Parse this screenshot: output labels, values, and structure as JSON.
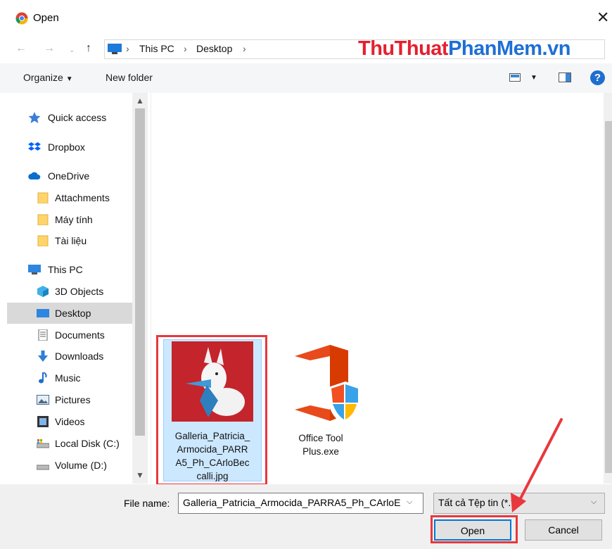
{
  "window": {
    "title": "Open"
  },
  "address": {
    "crumbs": [
      "This PC",
      "Desktop"
    ],
    "watermark_red": "ThuThuat",
    "watermark_blue": "PhanMem.vn"
  },
  "toolbar": {
    "organize": "Organize",
    "new_folder": "New folder"
  },
  "nav": {
    "items": [
      {
        "label": "Quick access",
        "icon": "star-icon"
      },
      {
        "label": "Dropbox",
        "icon": "dropbox-icon"
      },
      {
        "label": "OneDrive",
        "icon": "cloud-icon"
      },
      {
        "label": "Attachments",
        "icon": "folder-icon"
      },
      {
        "label": "Máy tính",
        "icon": "folder-icon"
      },
      {
        "label": "Tài liệu",
        "icon": "folder-icon"
      },
      {
        "label": "This PC",
        "icon": "computer-icon"
      },
      {
        "label": "3D Objects",
        "icon": "cube-icon"
      },
      {
        "label": "Desktop",
        "icon": "desktop-icon"
      },
      {
        "label": "Documents",
        "icon": "document-icon"
      },
      {
        "label": "Downloads",
        "icon": "download-icon"
      },
      {
        "label": "Music",
        "icon": "music-icon"
      },
      {
        "label": "Pictures",
        "icon": "pictures-icon"
      },
      {
        "label": "Videos",
        "icon": "film-icon"
      },
      {
        "label": "Local Disk (C:)",
        "icon": "drive-icon"
      },
      {
        "label": "Volume (D:)",
        "icon": "drive-icon"
      }
    ],
    "selected": "Desktop"
  },
  "files": [
    {
      "name_lines": [
        "Galleria_Patricia_",
        "Armocida_PARR",
        "A5_Ph_CArloBec",
        "calli.jpg"
      ],
      "selected": true
    },
    {
      "name_lines": [
        "Office Tool",
        "Plus.exe"
      ],
      "selected": false
    }
  ],
  "bottom": {
    "file_name_label": "File name:",
    "file_name_value": "Galleria_Patricia_Armocida_PARRA5_Ph_CArloE",
    "file_type": "Tất cả Tệp tin (*.*)",
    "open_label": "Open",
    "cancel_label": "Cancel"
  },
  "colors": {
    "highlight_red": "#e8383d",
    "selection_blue": "#cce8ff",
    "accent": "#0078d7"
  }
}
